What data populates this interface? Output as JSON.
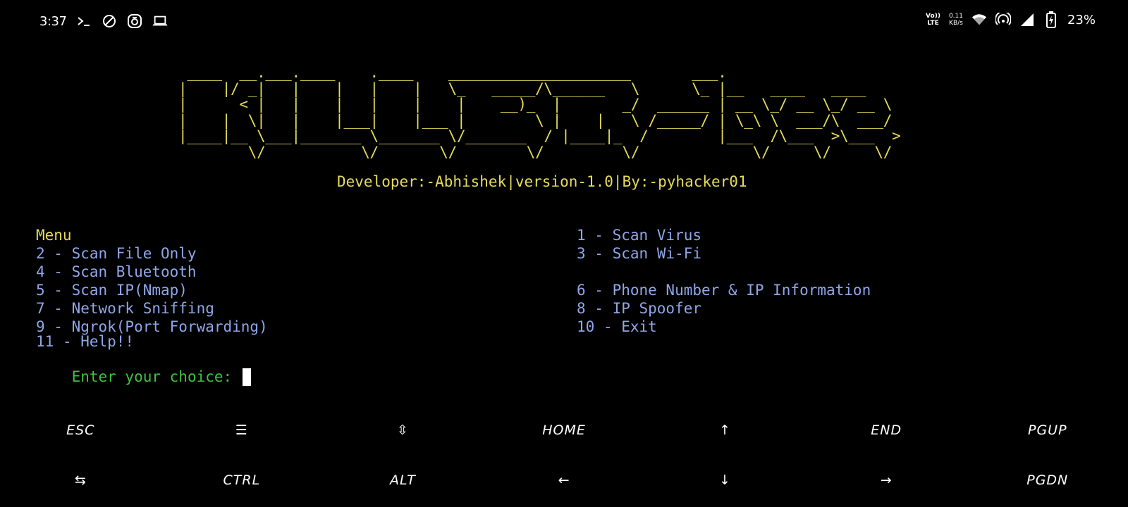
{
  "status_bar": {
    "time": "3:37",
    "left_icons": [
      "terminal-prompt-icon",
      "do-not-disturb-icon",
      "camera-icon",
      "laptop-icon"
    ],
    "network_label_top": "Vo))",
    "network_label_bottom": "LTE",
    "speed_top": "0.11",
    "speed_bottom": "KB/s",
    "right_icons": [
      "wifi-icon",
      "hotspot-icon",
      "cell-signal-icon",
      "battery-charging-icon"
    ],
    "battery_percent": "23%"
  },
  "terminal": {
    "banner_art": " ____  __.___.____    .____    _____________________       ___.                  \n|    |/ _|   |    |   |    |   \\_   _____/\\______   \\      \\_ |__   ____   ____  \n|      < |   |    |   |    |    |    __)_  |       _/  ______ | __ \\_/ __ \\_/ __ \\ \n|    |  \\|   |    |___|    |___ |        \\ |    |   \\ /_____/ | \\_\\ \\  ___/\\  ___/ \n|____|__ \\___|_______ \\_______ \\/_______  / |____|_  /        |___  /\\___  >\\___  >\n        \\/           \\/       \\/        \\/         \\/             \\/     \\/     \\/ ",
    "developer_line": "Developer:-Abhishek|version-1.0|By:-pyhacker01",
    "menu_title": "Menu",
    "options": {
      "o1": "1 - Scan Virus",
      "o2": "2 - Scan File Only",
      "o3": "3 - Scan Wi-Fi",
      "o4": "4 - Scan Bluetooth",
      "o5": "5 - Scan IP(Nmap)",
      "o6": "6 - Phone Number & IP Information",
      "o7": "7 - Network Sniffing",
      "o8": "8 - IP Spoofer",
      "o9": "9 - Ngrok(Port Forwarding)",
      "o10": "10 - Exit",
      "o11": "11 - Help!!"
    },
    "prompt": "Enter your choice: "
  },
  "extra_keys": {
    "row1": [
      "ESC",
      "☰",
      "⇳",
      "HOME",
      "↑",
      "END",
      "PGUP"
    ],
    "row2": [
      "⇆",
      "CTRL",
      "ALT",
      "←",
      "↓",
      "→",
      "PGDN"
    ]
  }
}
